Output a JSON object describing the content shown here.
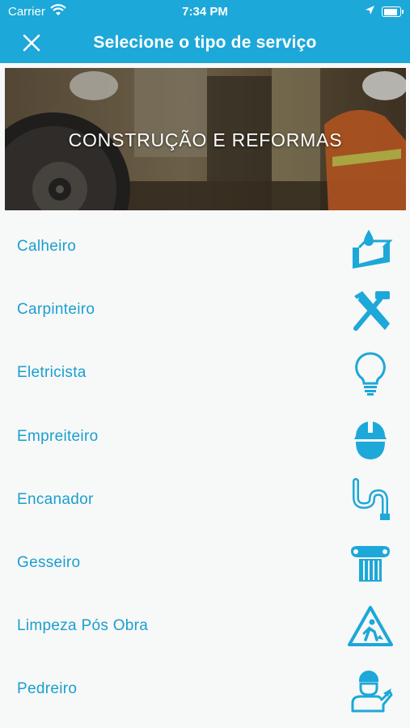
{
  "status_bar": {
    "carrier": "Carrier",
    "time": "7:34 PM",
    "battery_level": 0.9
  },
  "header": {
    "title": "Selecione o tipo de serviço",
    "close_icon": "close-icon"
  },
  "banner": {
    "title": "CONSTRUÇÃO E REFORMAS"
  },
  "services": [
    {
      "label": "Calheiro",
      "icon": "gutter-icon"
    },
    {
      "label": "Carpinteiro",
      "icon": "saw-hammer-icon"
    },
    {
      "label": "Eletricista",
      "icon": "lightbulb-icon"
    },
    {
      "label": "Empreiteiro",
      "icon": "hard-hat-icon"
    },
    {
      "label": "Encanador",
      "icon": "pipe-icon"
    },
    {
      "label": "Gesseiro",
      "icon": "column-icon"
    },
    {
      "label": "Limpeza Pós Obra",
      "icon": "warning-worker-icon"
    },
    {
      "label": "Pedreiro",
      "icon": "mason-icon"
    }
  ],
  "colors": {
    "accent": "#1ca8d8",
    "text": "#1a9fcf",
    "background": "#f7f8f8"
  }
}
